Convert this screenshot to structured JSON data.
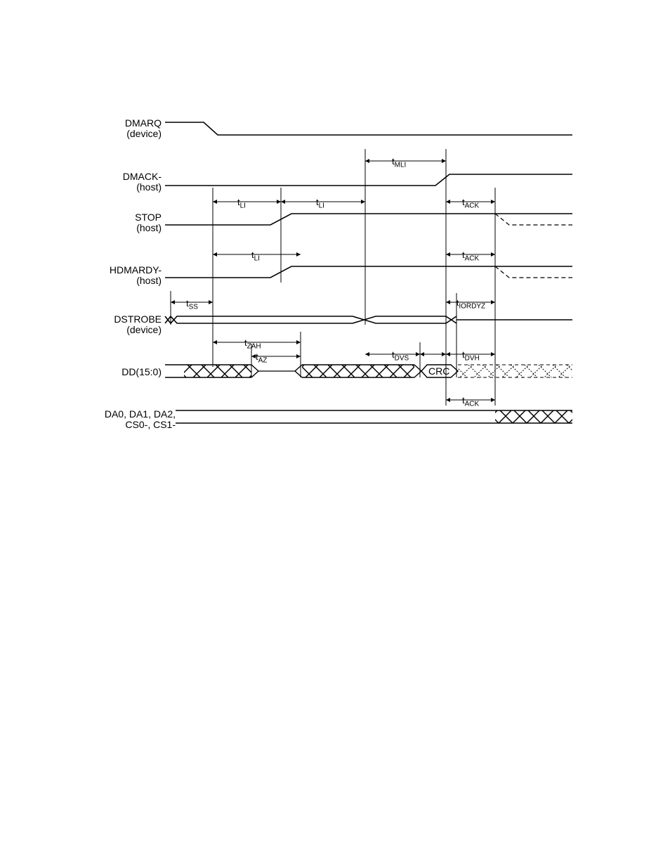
{
  "signals": {
    "dmarq": {
      "name": "DMARQ",
      "role": "(device)"
    },
    "dmack": {
      "name": "DMACK-",
      "role": "(host)"
    },
    "stop": {
      "name": "STOP",
      "role": "(host)"
    },
    "hdmardy": {
      "name": "HDMARDY-",
      "role": "(host)"
    },
    "dstrobe": {
      "name": "DSTROBE",
      "role": "(device)"
    },
    "dd": {
      "name": "DD(15:0)",
      "role": ""
    },
    "addr": {
      "name": "DA0, DA1, DA2,\nCS0-, CS1-",
      "role": ""
    }
  },
  "data_label": "CRC",
  "timing": {
    "tMLI": "t<sub>MLI</sub>",
    "tLI_1": "t<sub>LI</sub>",
    "tLI_2": "t<sub>LI</sub>",
    "tLI_3": "t<sub>LI</sub>",
    "tACK_1": "t<sub>ACK</sub>",
    "tACK_2": "t<sub>ACK</sub>",
    "tACK_3": "t<sub>ACK</sub>",
    "tSS": "t<sub>SS</sub>",
    "tIORDYZ": "t<sub>IORDYZ</sub>",
    "tZAH": "t<sub>ZAH</sub>",
    "tAZ": "t<sub>AZ</sub>",
    "tDVS": "t<sub>DVS</sub>",
    "tDVH": "t<sub>DVH</sub>"
  }
}
